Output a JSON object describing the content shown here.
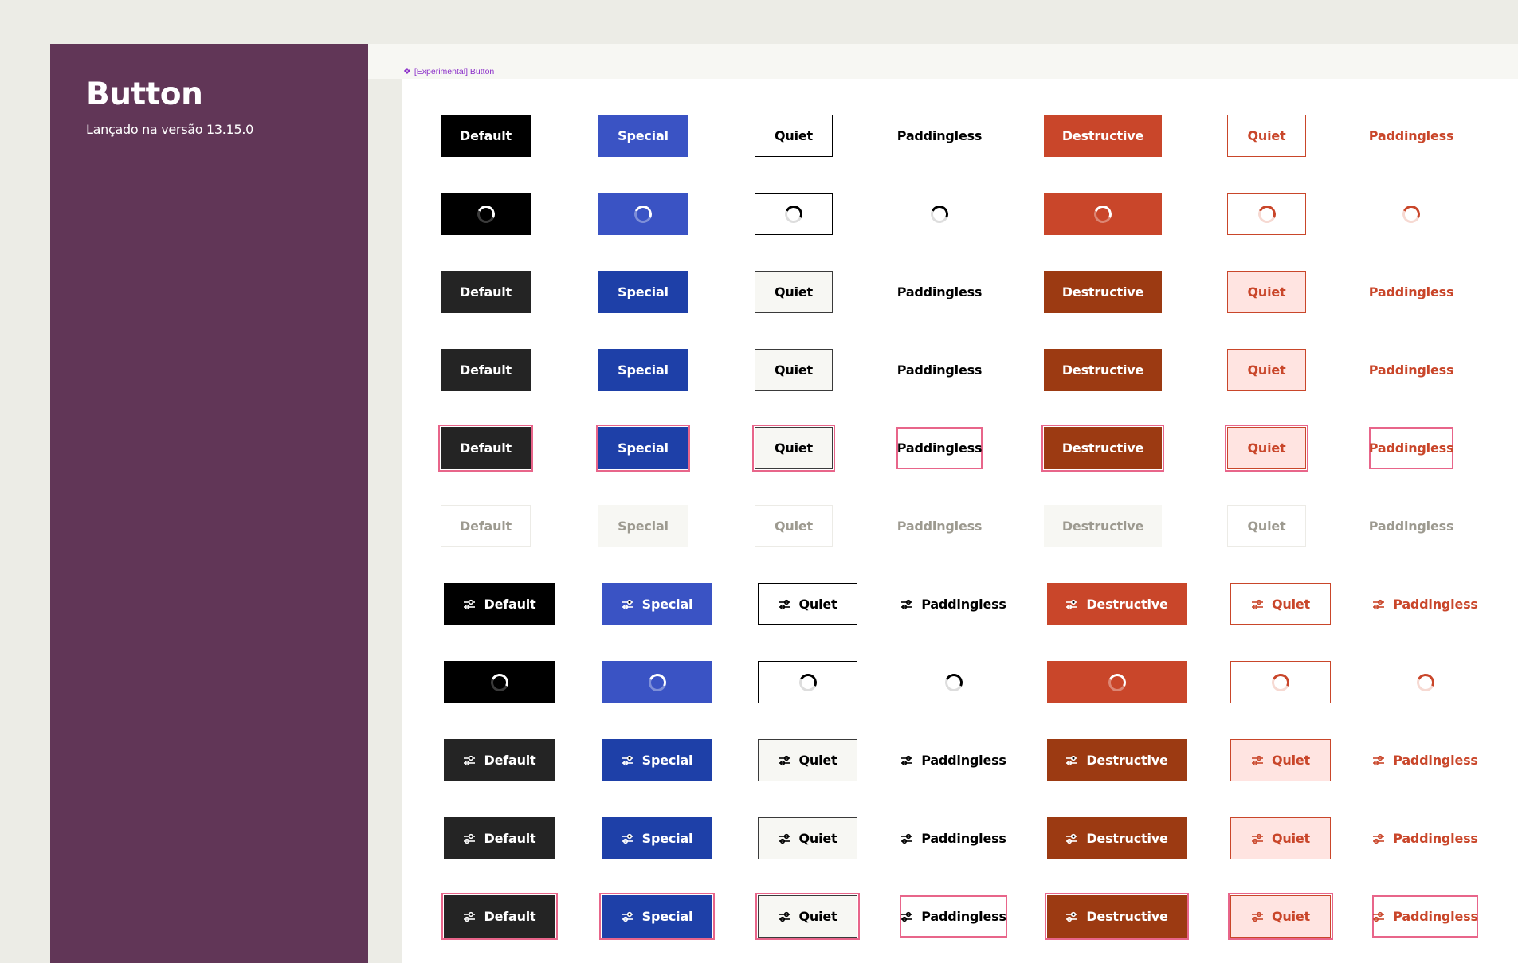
{
  "sidebar": {
    "title": "Button",
    "subtitle": "Lançado na versão 13.15.0"
  },
  "component_label": "[Experimental] Button",
  "icons": {
    "diamond": "component-icon",
    "settings": "sliders-icon",
    "loading": "spinner-icon"
  },
  "columns": [
    {
      "key": "default",
      "label": "Default"
    },
    {
      "key": "special",
      "label": "Special"
    },
    {
      "key": "quiet",
      "label": "Quiet"
    },
    {
      "key": "paddingless",
      "label": "Paddingless"
    },
    {
      "key": "destructive",
      "label": "Destructive"
    },
    {
      "key": "quiet-destructive",
      "label": "Quiet"
    },
    {
      "key": "paddingless-destructive",
      "label": "Paddingless"
    }
  ],
  "rows": [
    {
      "state": "default",
      "icon": false
    },
    {
      "state": "loading",
      "icon": false
    },
    {
      "state": "hover",
      "icon": false
    },
    {
      "state": "active",
      "icon": false
    },
    {
      "state": "focus",
      "icon": false
    },
    {
      "state": "disabled",
      "icon": false
    },
    {
      "state": "default",
      "icon": true
    },
    {
      "state": "loading",
      "icon": true
    },
    {
      "state": "hover",
      "icon": true
    },
    {
      "state": "active",
      "icon": true
    },
    {
      "state": "focus",
      "icon": true
    }
  ],
  "colors": {
    "sidebar": "#613657",
    "background": "#ECECE6",
    "canvas": "#FFFFFF",
    "component_label": "#8B2FC9",
    "default": "#000000",
    "default_hover": "#242424",
    "special": "#3A53C4",
    "special_hover": "#1E40A8",
    "destructive": "#C9462A",
    "destructive_hover": "#9C3A12",
    "quiet_hover_bg": "#F7F7F3",
    "quiet_destructive_hover_bg": "#FFE4E1",
    "focus_ring": "#E8658A",
    "disabled_bg": "#F7F7F3",
    "disabled_text": "#9D9A90"
  }
}
